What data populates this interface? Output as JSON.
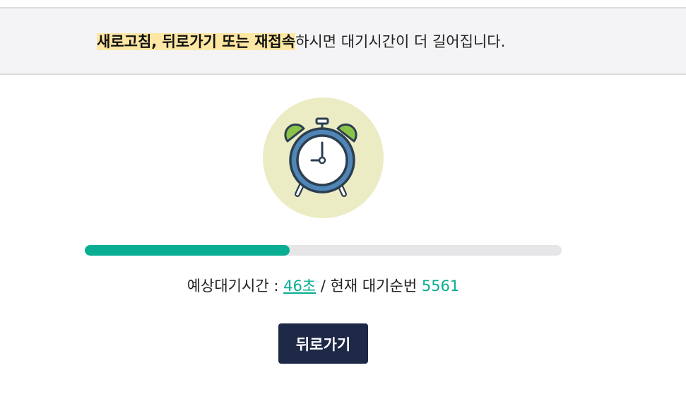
{
  "notice": {
    "highlight": "새로고침, 뒤로가기 또는 재접속",
    "rest": "하시면 대기시간이 더 길어집니다."
  },
  "illustration": {
    "icon": "alarm-clock-icon",
    "background_color": "#ececc4"
  },
  "progress": {
    "fraction": 0.43,
    "fill_color": "#09ad92",
    "track_color": "#e6e6e8"
  },
  "wait": {
    "label": "예상대기시간 : ",
    "time": "46초",
    "separator": " / 현재 대기순번 ",
    "queue_number": "5561"
  },
  "actions": {
    "back_label": "뒤로가기"
  },
  "colors": {
    "accent": "#09ad92",
    "button_bg": "#1e2847",
    "highlight_bg": "#fde7a3"
  }
}
